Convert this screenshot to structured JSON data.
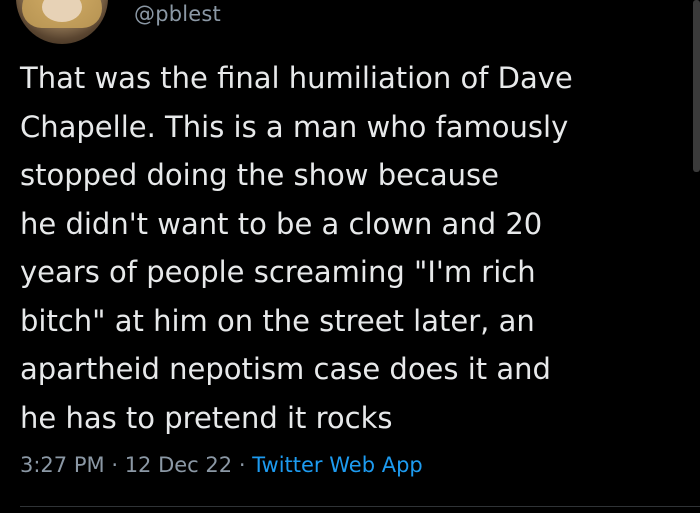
{
  "tweet": {
    "handle": "@pblest",
    "text": "That was the final humiliation of Dave\nChapelle. This is a man who famously\nstopped doing the show because\nhe didn't want to be a clown and 20\nyears of people screaming \"I'm rich\nbitch\" at him on the street later, an\napartheid nepotism case does it and\nhe has to pretend it rocks",
    "time": "3:27 PM",
    "separator1": "·",
    "date": "12 Dec 22",
    "separator2": "·",
    "source": "Twitter Web App"
  },
  "colors": {
    "background": "#000000",
    "text": "#e7e9ea",
    "muted": "#8b98a5",
    "accent": "#1d9bf0"
  },
  "icons": {
    "avatar": "profile-avatar"
  }
}
